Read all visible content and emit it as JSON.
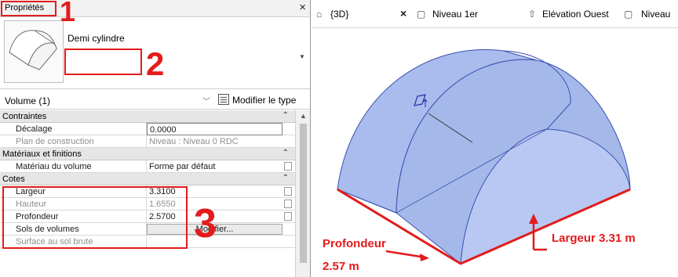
{
  "properties_panel": {
    "title": "Propriétés",
    "close_glyph": "×",
    "type_name": "Demi cylindre",
    "instance_selector": "Volume (1)",
    "edit_type_label": "Modifier le type",
    "groups": {
      "constraints": "Contraintes",
      "materials": "Matériaux et finitions",
      "dimensions": "Cotes"
    },
    "params": {
      "offset": {
        "name": "Décalage",
        "value": "0.0000"
      },
      "work_plane": {
        "name": "Plan de construction",
        "value": "Niveau : Niveau 0 RDC"
      },
      "material": {
        "name": "Matériau du volume",
        "value": "Forme par défaut"
      },
      "width": {
        "name": "Largeur",
        "value": "3.3100"
      },
      "height": {
        "name": "Hauteur",
        "value": "1.6550"
      },
      "depth": {
        "name": "Profondeur",
        "value": "2.5700"
      },
      "mass_floors": {
        "name": "Sols de volumes",
        "button": "Modifier..."
      },
      "gross_floor_area": {
        "name": "Surface au sol brute",
        "value": ""
      }
    }
  },
  "annotations": {
    "n1": "1",
    "n2": "2",
    "n3": "3"
  },
  "tabs": [
    {
      "label": "{3D}",
      "icon": "3d-view-icon",
      "close": "×"
    },
    {
      "label": "Niveau 1er",
      "icon": "floor-plan-icon"
    },
    {
      "label": "Elévation Ouest",
      "icon": "elevation-icon"
    },
    {
      "label": "Niveau",
      "icon": "floor-plan-icon"
    }
  ],
  "viewport_labels": {
    "depth": "Profondeur",
    "depth_value": "2.57 m",
    "width": "Largeur 3.31 m"
  },
  "colors": {
    "annotation_red": "#e31b1b",
    "mass_fill": "#a5b8ea",
    "mass_edge": "#3a50b0"
  }
}
